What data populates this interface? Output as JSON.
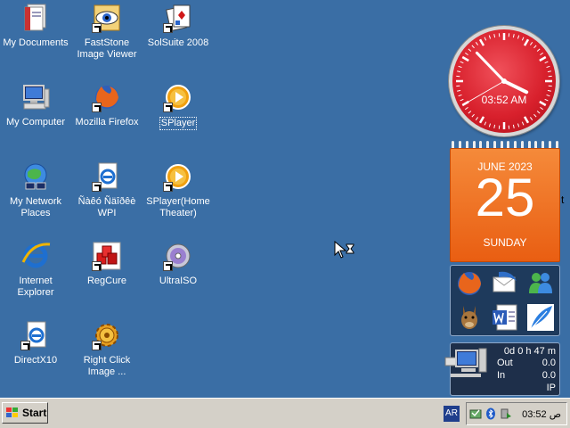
{
  "desktop_icons": [
    {
      "label": "My Documents",
      "icon": "my-documents-icon",
      "shortcut": false
    },
    {
      "label": "FastStone Image Viewer",
      "icon": "faststone-eye-icon",
      "shortcut": true
    },
    {
      "label": "SolSuite 2008",
      "icon": "solsuite-cards-icon",
      "shortcut": true
    },
    {
      "label": "My Computer",
      "icon": "my-computer-icon",
      "shortcut": false
    },
    {
      "label": "Mozilla Firefox",
      "icon": "firefox-icon",
      "shortcut": true
    },
    {
      "label": "SPlayer",
      "icon": "splayer-icon",
      "shortcut": true
    },
    {
      "label": "My Network Places",
      "icon": "network-places-icon",
      "shortcut": false
    },
    {
      "label": "Ñàêó Ñäîðêè WPI",
      "icon": "wpi-document-icon",
      "shortcut": true
    },
    {
      "label": "SPlayer(Home Theater)",
      "icon": "splayer-icon",
      "shortcut": true
    },
    {
      "label": "Internet Explorer",
      "icon": "internet-explorer-icon",
      "shortcut": false
    },
    {
      "label": "RegCure",
      "icon": "regcure-icon",
      "shortcut": true
    },
    {
      "label": "UltraISO",
      "icon": "ultraiso-disc-icon",
      "shortcut": true
    },
    {
      "label": "DirectX10",
      "icon": "directx-document-icon",
      "shortcut": true
    },
    {
      "label": "Right Click Image ...",
      "icon": "gear-icon",
      "shortcut": true
    }
  ],
  "clock": {
    "time": "03:52 AM",
    "hour": 3,
    "minute": 52,
    "second": 40
  },
  "calendar": {
    "month": "JUNE 2023",
    "day": "25",
    "weekday": "SUNDAY",
    "accent": "#e95e12"
  },
  "launcher": {
    "items": [
      "firefox-icon",
      "thunderbird-icon",
      "messenger-icon",
      "emule-mule-icon",
      "word-document-icon",
      "feather-icon"
    ]
  },
  "netmon": {
    "uptime": "0d 0 h 47 m",
    "out_label": "Out",
    "out_value": "0.0",
    "in_label": "In",
    "in_value": "0.0",
    "ip_label": "IP"
  },
  "edge_fragment": "t",
  "taskbar": {
    "start_label": "Start",
    "language": "AR",
    "time": "03:52 ص",
    "tray_icons": [
      "antivirus-icon",
      "bluetooth-icon",
      "safely-remove-icon"
    ]
  },
  "colors": {
    "desktop": "#3a6ea5",
    "taskbar": "#d4d0c8",
    "clock_face": "#d8202c"
  }
}
